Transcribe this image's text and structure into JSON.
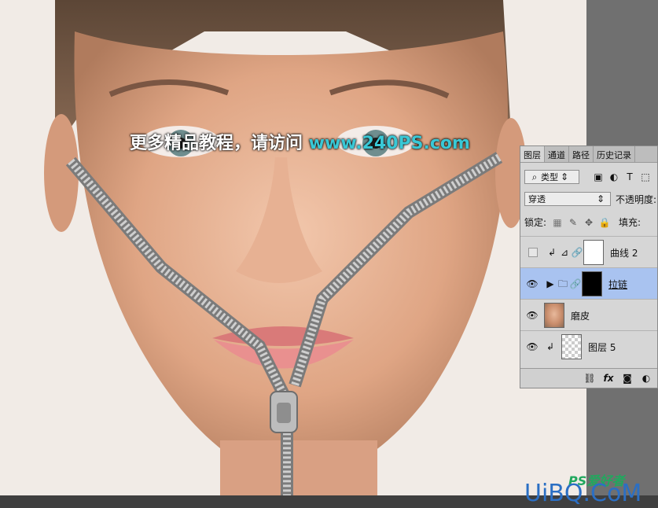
{
  "watermark": {
    "cn_text": "更多精品教程，请访问 ",
    "url": "www.240PS.com"
  },
  "logo": {
    "ps": "PS爱好者",
    "uibq": "UiBQ.CoM"
  },
  "panel": {
    "tabs": [
      "图层",
      "通道",
      "路径",
      "历史记录"
    ],
    "filter_select": "类型",
    "blend_mode": "穿透",
    "opacity_label": "不透明度:",
    "lock_label": "锁定:",
    "fill_label": "填充:",
    "layers": [
      {
        "name": "曲线 2",
        "visible": false
      },
      {
        "name": "拉链",
        "visible": true,
        "selected": true
      },
      {
        "name": "磨皮",
        "visible": true
      },
      {
        "name": "图层 5",
        "visible": true
      }
    ]
  },
  "colors": {
    "accent": "#39c8d6",
    "selected": "#a9c3f0"
  }
}
